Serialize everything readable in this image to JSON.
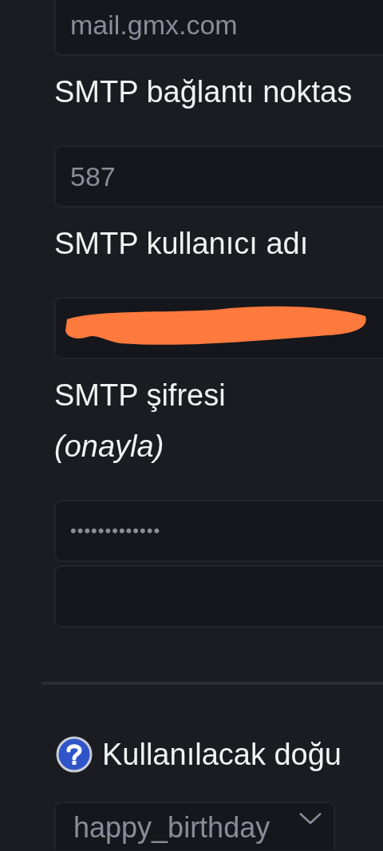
{
  "items": [
    {
      "kind": "field",
      "value": "mail.gmx.com"
    },
    {
      "kind": "label",
      "text": "SMTP bağlantı noktas"
    },
    {
      "kind": "field",
      "value": "587"
    },
    {
      "kind": "label",
      "text": "SMTP kullanıcı adı"
    },
    {
      "kind": "field",
      "redacted": true
    },
    {
      "kind": "label",
      "text": "SMTP şifresi"
    },
    {
      "kind": "note",
      "text": "(onayla)"
    },
    {
      "kind": "password",
      "value": "•••••••••••••"
    },
    {
      "kind": "password",
      "value": ""
    },
    {
      "kind": "divider"
    },
    {
      "kind": "help_label",
      "text": "Kullanılacak doğu"
    },
    {
      "kind": "select",
      "value": "happy_birthday"
    }
  ]
}
